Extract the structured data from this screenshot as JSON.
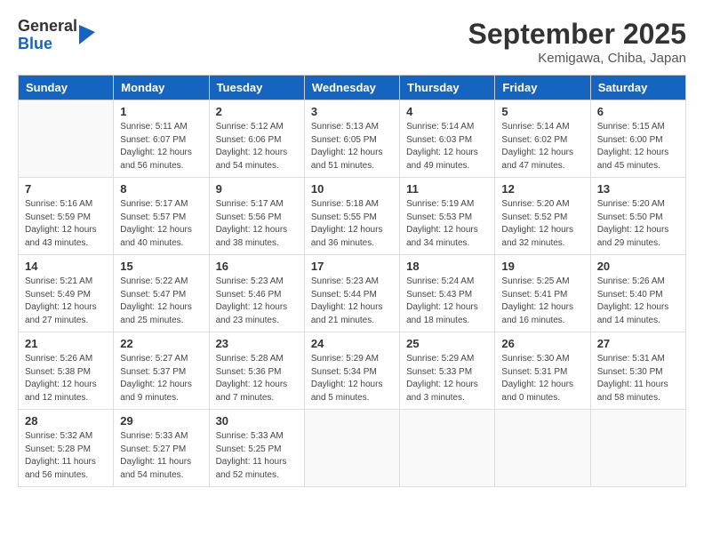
{
  "header": {
    "logo": {
      "general": "General",
      "blue": "Blue"
    },
    "month": "September 2025",
    "location": "Kemigawa, Chiba, Japan"
  },
  "weekdays": [
    "Sunday",
    "Monday",
    "Tuesday",
    "Wednesday",
    "Thursday",
    "Friday",
    "Saturday"
  ],
  "weeks": [
    [
      {
        "day": "",
        "info": ""
      },
      {
        "day": "1",
        "info": "Sunrise: 5:11 AM\nSunset: 6:07 PM\nDaylight: 12 hours\nand 56 minutes."
      },
      {
        "day": "2",
        "info": "Sunrise: 5:12 AM\nSunset: 6:06 PM\nDaylight: 12 hours\nand 54 minutes."
      },
      {
        "day": "3",
        "info": "Sunrise: 5:13 AM\nSunset: 6:05 PM\nDaylight: 12 hours\nand 51 minutes."
      },
      {
        "day": "4",
        "info": "Sunrise: 5:14 AM\nSunset: 6:03 PM\nDaylight: 12 hours\nand 49 minutes."
      },
      {
        "day": "5",
        "info": "Sunrise: 5:14 AM\nSunset: 6:02 PM\nDaylight: 12 hours\nand 47 minutes."
      },
      {
        "day": "6",
        "info": "Sunrise: 5:15 AM\nSunset: 6:00 PM\nDaylight: 12 hours\nand 45 minutes."
      }
    ],
    [
      {
        "day": "7",
        "info": "Sunrise: 5:16 AM\nSunset: 5:59 PM\nDaylight: 12 hours\nand 43 minutes."
      },
      {
        "day": "8",
        "info": "Sunrise: 5:17 AM\nSunset: 5:57 PM\nDaylight: 12 hours\nand 40 minutes."
      },
      {
        "day": "9",
        "info": "Sunrise: 5:17 AM\nSunset: 5:56 PM\nDaylight: 12 hours\nand 38 minutes."
      },
      {
        "day": "10",
        "info": "Sunrise: 5:18 AM\nSunset: 5:55 PM\nDaylight: 12 hours\nand 36 minutes."
      },
      {
        "day": "11",
        "info": "Sunrise: 5:19 AM\nSunset: 5:53 PM\nDaylight: 12 hours\nand 34 minutes."
      },
      {
        "day": "12",
        "info": "Sunrise: 5:20 AM\nSunset: 5:52 PM\nDaylight: 12 hours\nand 32 minutes."
      },
      {
        "day": "13",
        "info": "Sunrise: 5:20 AM\nSunset: 5:50 PM\nDaylight: 12 hours\nand 29 minutes."
      }
    ],
    [
      {
        "day": "14",
        "info": "Sunrise: 5:21 AM\nSunset: 5:49 PM\nDaylight: 12 hours\nand 27 minutes."
      },
      {
        "day": "15",
        "info": "Sunrise: 5:22 AM\nSunset: 5:47 PM\nDaylight: 12 hours\nand 25 minutes."
      },
      {
        "day": "16",
        "info": "Sunrise: 5:23 AM\nSunset: 5:46 PM\nDaylight: 12 hours\nand 23 minutes."
      },
      {
        "day": "17",
        "info": "Sunrise: 5:23 AM\nSunset: 5:44 PM\nDaylight: 12 hours\nand 21 minutes."
      },
      {
        "day": "18",
        "info": "Sunrise: 5:24 AM\nSunset: 5:43 PM\nDaylight: 12 hours\nand 18 minutes."
      },
      {
        "day": "19",
        "info": "Sunrise: 5:25 AM\nSunset: 5:41 PM\nDaylight: 12 hours\nand 16 minutes."
      },
      {
        "day": "20",
        "info": "Sunrise: 5:26 AM\nSunset: 5:40 PM\nDaylight: 12 hours\nand 14 minutes."
      }
    ],
    [
      {
        "day": "21",
        "info": "Sunrise: 5:26 AM\nSunset: 5:38 PM\nDaylight: 12 hours\nand 12 minutes."
      },
      {
        "day": "22",
        "info": "Sunrise: 5:27 AM\nSunset: 5:37 PM\nDaylight: 12 hours\nand 9 minutes."
      },
      {
        "day": "23",
        "info": "Sunrise: 5:28 AM\nSunset: 5:36 PM\nDaylight: 12 hours\nand 7 minutes."
      },
      {
        "day": "24",
        "info": "Sunrise: 5:29 AM\nSunset: 5:34 PM\nDaylight: 12 hours\nand 5 minutes."
      },
      {
        "day": "25",
        "info": "Sunrise: 5:29 AM\nSunset: 5:33 PM\nDaylight: 12 hours\nand 3 minutes."
      },
      {
        "day": "26",
        "info": "Sunrise: 5:30 AM\nSunset: 5:31 PM\nDaylight: 12 hours\nand 0 minutes."
      },
      {
        "day": "27",
        "info": "Sunrise: 5:31 AM\nSunset: 5:30 PM\nDaylight: 11 hours\nand 58 minutes."
      }
    ],
    [
      {
        "day": "28",
        "info": "Sunrise: 5:32 AM\nSunset: 5:28 PM\nDaylight: 11 hours\nand 56 minutes."
      },
      {
        "day": "29",
        "info": "Sunrise: 5:33 AM\nSunset: 5:27 PM\nDaylight: 11 hours\nand 54 minutes."
      },
      {
        "day": "30",
        "info": "Sunrise: 5:33 AM\nSunset: 5:25 PM\nDaylight: 11 hours\nand 52 minutes."
      },
      {
        "day": "",
        "info": ""
      },
      {
        "day": "",
        "info": ""
      },
      {
        "day": "",
        "info": ""
      },
      {
        "day": "",
        "info": ""
      }
    ]
  ]
}
